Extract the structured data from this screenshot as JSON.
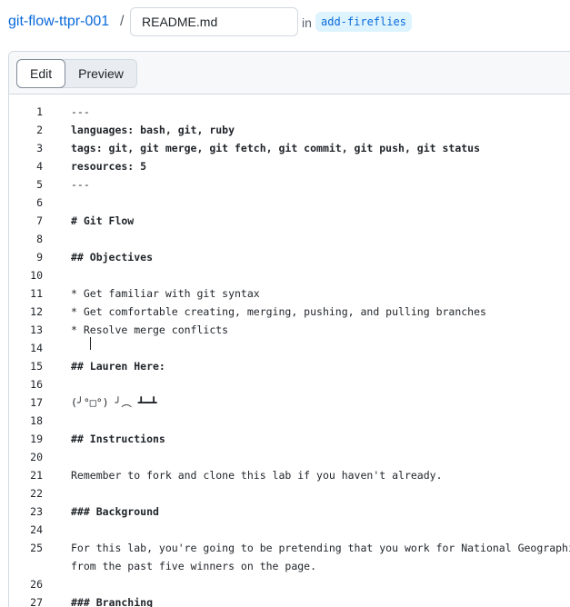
{
  "header": {
    "repo": "git-flow-ttpr-001",
    "separator": "/",
    "filename": "README.md",
    "in_label": "in",
    "branch": "add-fireflies"
  },
  "tabs": {
    "edit": "Edit",
    "preview": "Preview"
  },
  "editor": {
    "lines": [
      {
        "n": "1",
        "t": "---",
        "bold": false
      },
      {
        "n": "2",
        "t": "languages: bash, git, ruby",
        "bold": true
      },
      {
        "n": "3",
        "t": "tags: git, git merge, git fetch, git commit, git push, git status",
        "bold": true
      },
      {
        "n": "4",
        "t": "resources: 5",
        "bold": true
      },
      {
        "n": "5",
        "t": "---",
        "bold": false
      },
      {
        "n": "6",
        "t": "",
        "bold": false
      },
      {
        "n": "7",
        "t": "# Git Flow",
        "bold": true
      },
      {
        "n": "8",
        "t": "",
        "bold": false
      },
      {
        "n": "9",
        "t": "## Objectives",
        "bold": true
      },
      {
        "n": "10",
        "t": "",
        "bold": false
      },
      {
        "n": "11",
        "t": "* Get familiar with git syntax",
        "bold": false
      },
      {
        "n": "12",
        "t": "* Get comfortable creating, merging, pushing, and pulling branches",
        "bold": false
      },
      {
        "n": "13",
        "t": "* Resolve merge conflicts",
        "bold": false
      },
      {
        "n": "14",
        "t": "",
        "bold": false
      },
      {
        "n": "15",
        "t": "## Lauren Here:",
        "bold": true
      },
      {
        "n": "16",
        "t": "",
        "bold": false
      },
      {
        "n": "17",
        "t": "(╯°□°) ╯︵ ┻━┻",
        "bold": false
      },
      {
        "n": "18",
        "t": "",
        "bold": false
      },
      {
        "n": "19",
        "t": "## Instructions",
        "bold": true
      },
      {
        "n": "20",
        "t": "",
        "bold": false
      },
      {
        "n": "21",
        "t": "Remember to fork and clone this lab if you haven't already.",
        "bold": false
      },
      {
        "n": "22",
        "t": "",
        "bold": false
      },
      {
        "n": "23",
        "t": "### Background",
        "bold": true
      },
      {
        "n": "24",
        "t": "",
        "bold": false
      },
      {
        "n": "25",
        "t": "For this lab, you're going to be pretending that you work for National Geographic's",
        "bold": false
      },
      {
        "n": "",
        "t": "from the past five winners on the page.",
        "bold": false
      },
      {
        "n": "26",
        "t": "",
        "bold": false
      },
      {
        "n": "27",
        "t": "### Branching",
        "bold": true
      }
    ]
  }
}
